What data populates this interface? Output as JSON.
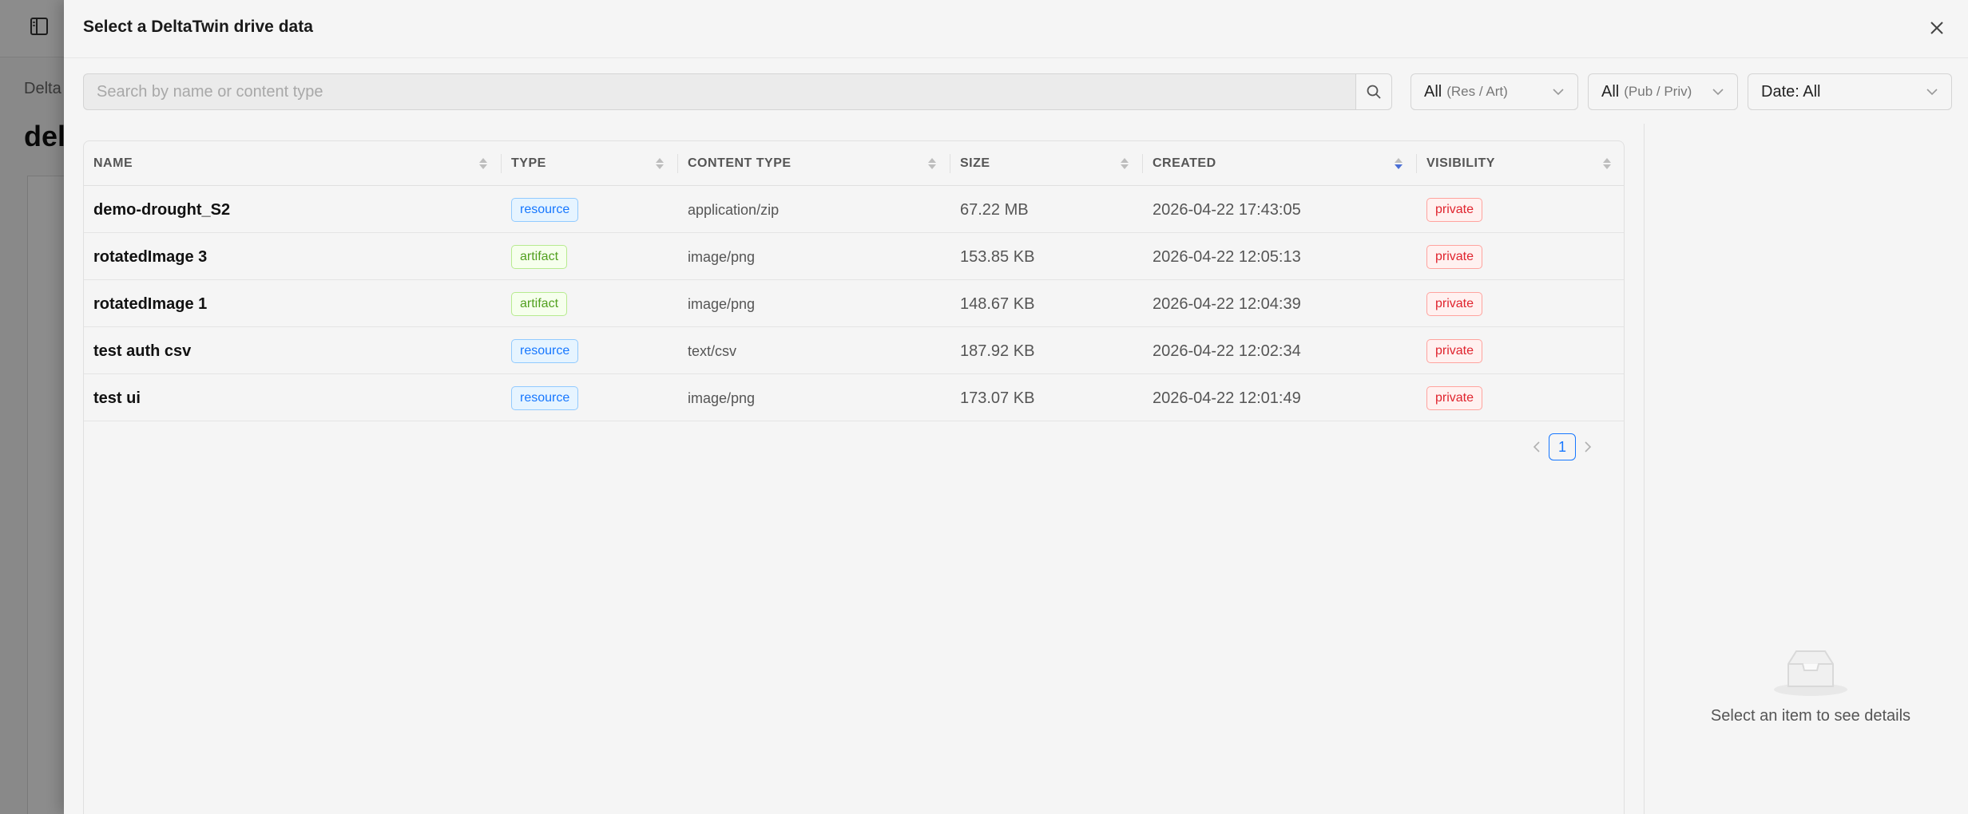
{
  "background": {
    "breadcrumb": "Delta",
    "title": "del"
  },
  "drawer": {
    "title": "Select a DeltaTwin drive data"
  },
  "filters": {
    "search_placeholder": "Search by name or content type",
    "kind_main": "All",
    "kind_sub": "(Res / Art)",
    "access_main": "All",
    "access_sub": "(Pub / Priv)",
    "date": "Date: All"
  },
  "table": {
    "columns": {
      "name": "NAME",
      "type": "TYPE",
      "content_type": "CONTENT TYPE",
      "size": "SIZE",
      "created": "CREATED",
      "visibility": "VISIBILITY"
    },
    "rows": [
      {
        "name": "demo-drought_S2",
        "type": "resource",
        "content_type": "application/zip",
        "size": "67.22 MB",
        "created": "2026-04-22 17:43:05",
        "visibility": "private"
      },
      {
        "name": "rotatedImage 3",
        "type": "artifact",
        "content_type": "image/png",
        "size": "153.85 KB",
        "created": "2026-04-22 12:05:13",
        "visibility": "private"
      },
      {
        "name": "rotatedImage 1",
        "type": "artifact",
        "content_type": "image/png",
        "size": "148.67 KB",
        "created": "2026-04-22 12:04:39",
        "visibility": "private"
      },
      {
        "name": "test auth csv",
        "type": "resource",
        "content_type": "text/csv",
        "size": "187.92 KB",
        "created": "2026-04-22 12:02:34",
        "visibility": "private"
      },
      {
        "name": "test ui",
        "type": "resource",
        "content_type": "image/png",
        "size": "173.07 KB",
        "created": "2026-04-22 12:01:49",
        "visibility": "private"
      }
    ],
    "sorted_column": "created",
    "sort_color": "#4a6fd6"
  },
  "pagination": {
    "current_page": "1"
  },
  "details": {
    "empty_text": "Select an item to see details"
  },
  "colors": {
    "resource": "#1677ff",
    "artifact": "#52a01f",
    "private": "#e0242e",
    "accent": "#1677ff"
  }
}
